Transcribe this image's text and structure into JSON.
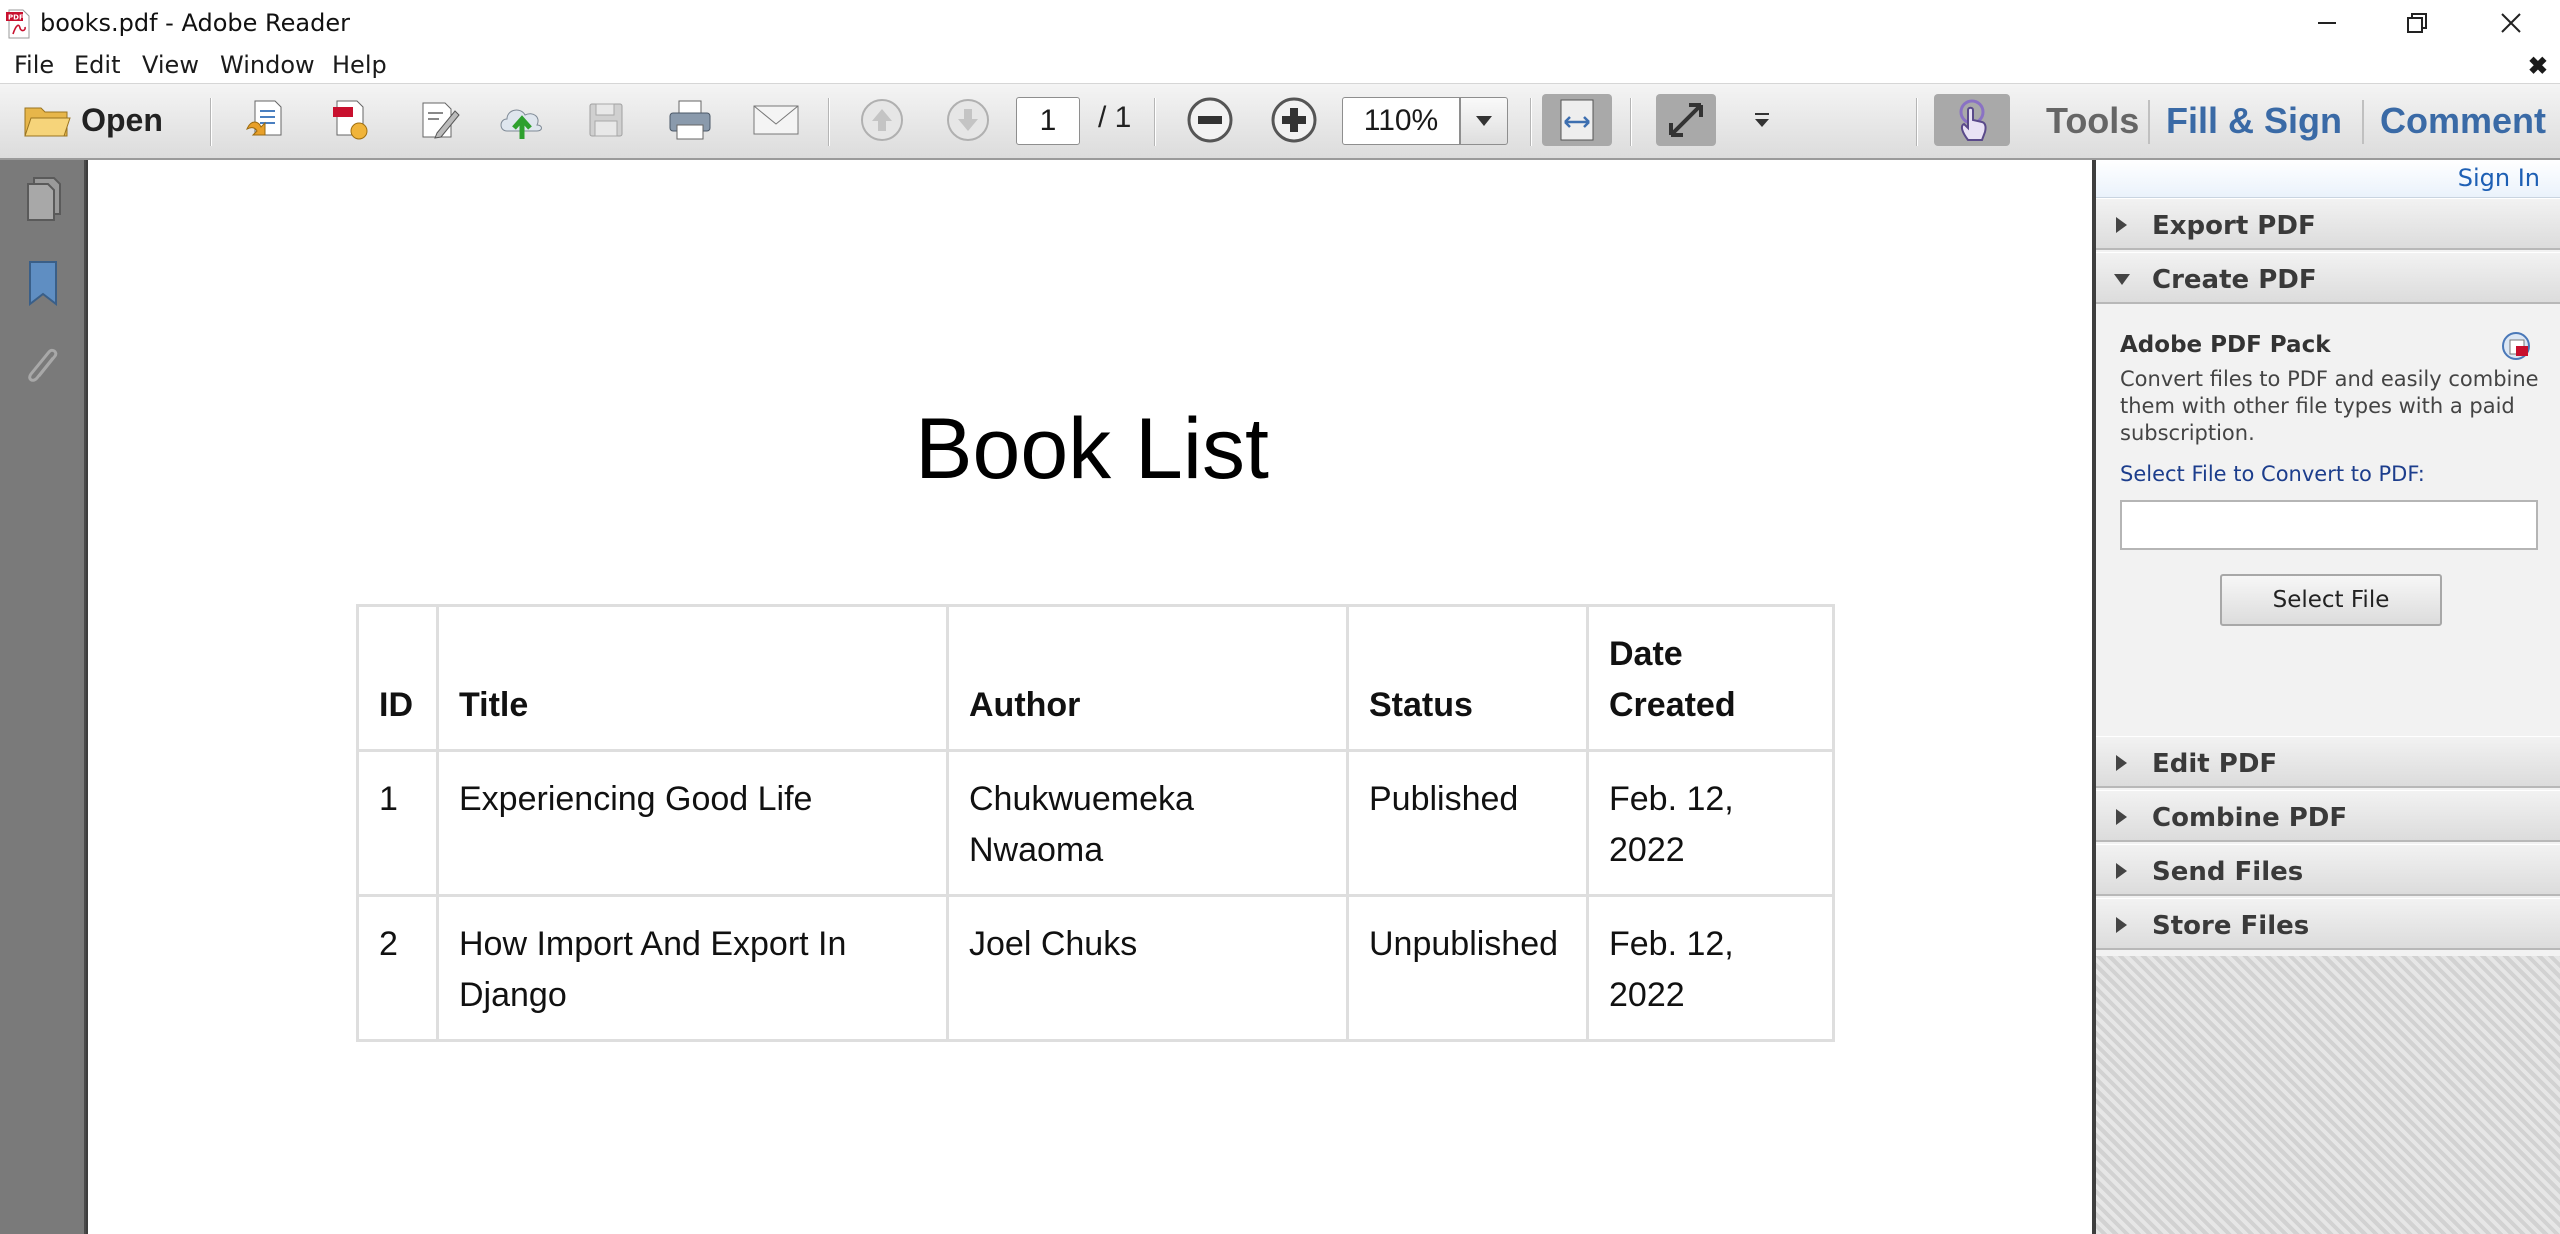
{
  "window": {
    "title": "books.pdf - Adobe Reader"
  },
  "menu": {
    "items": [
      "File",
      "Edit",
      "View",
      "Window",
      "Help"
    ],
    "close_doc": "✖"
  },
  "toolbar": {
    "open_label": "Open",
    "page_current": "1",
    "page_total": "/ 1",
    "zoom": "110%",
    "tools_label": "Tools",
    "fill_sign_label": "Fill & Sign",
    "comment_label": "Comment",
    "colors": {
      "tools": "#666666",
      "fill_sign": "#3a6aa6",
      "comment": "#3a6aa6"
    }
  },
  "document": {
    "heading": "Book List",
    "table": {
      "headers": [
        "ID",
        "Title",
        "Author",
        "Status",
        "Date Created"
      ],
      "rows": [
        [
          "1",
          "Experiencing Good Life",
          "Chukwuemeka Nwaoma",
          "Published",
          "Feb. 12, 2022"
        ],
        [
          "2",
          "How Import And Export In Django",
          "Joel Chuks",
          "Unpublished",
          "Feb. 12, 2022"
        ]
      ]
    }
  },
  "right_pane": {
    "sign_in": "Sign In",
    "sections": {
      "export_pdf": "Export PDF",
      "create_pdf": "Create PDF",
      "edit_pdf": "Edit PDF",
      "combine_pdf": "Combine PDF",
      "send_files": "Send Files",
      "store_files": "Store Files"
    },
    "create": {
      "pack_title": "Adobe PDF Pack",
      "description": "Convert files to PDF and easily combine them with other file types with a paid subscription.",
      "select_label": "Select File to Convert to PDF:",
      "file_value": "",
      "button_label": "Select File"
    }
  }
}
